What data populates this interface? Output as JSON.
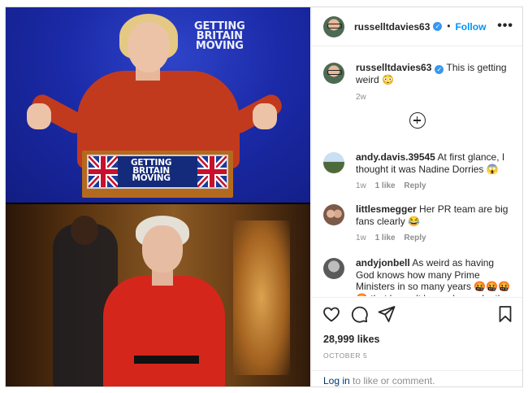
{
  "media": {
    "top_slogan_wall": "GETTING\nBRITAIN\nMOVING",
    "podium_slogan": "GETTING\nBRITAIN\nMOVING"
  },
  "post": {
    "username": "russelltdavies63",
    "follow_label": "Follow",
    "dot": "•",
    "more_label": "•••",
    "caption": {
      "username": "russelltdavies63",
      "text": "This is getting weird 😳",
      "time": "2w"
    }
  },
  "comments": [
    {
      "username": "andy.davis.39545",
      "text": "At first glance, I thought it was Nadine Dorries 😱",
      "time": "1w",
      "likes": "1 like",
      "reply": "Reply"
    },
    {
      "username": "littlesmegger",
      "text": "Her PR team are big fans clearly 😂",
      "time": "1w",
      "likes": "1 like",
      "reply": "Reply"
    },
    {
      "username": "andyjonbell",
      "text": "As weird as having God knows how many Prime Ministers in so many years 🤬🤬🤬🤬 that haven't been chosen by the people for the",
      "time": "",
      "likes": "",
      "reply": ""
    }
  ],
  "footer": {
    "likes": "28,999 likes",
    "date": "OCTOBER 5",
    "login_link": "Log in",
    "login_rest": " to like or comment."
  },
  "icons": [
    "heart-icon",
    "comment-icon",
    "share-icon",
    "bookmark-icon",
    "plus-circle-icon",
    "verified-icon",
    "more-icon"
  ]
}
